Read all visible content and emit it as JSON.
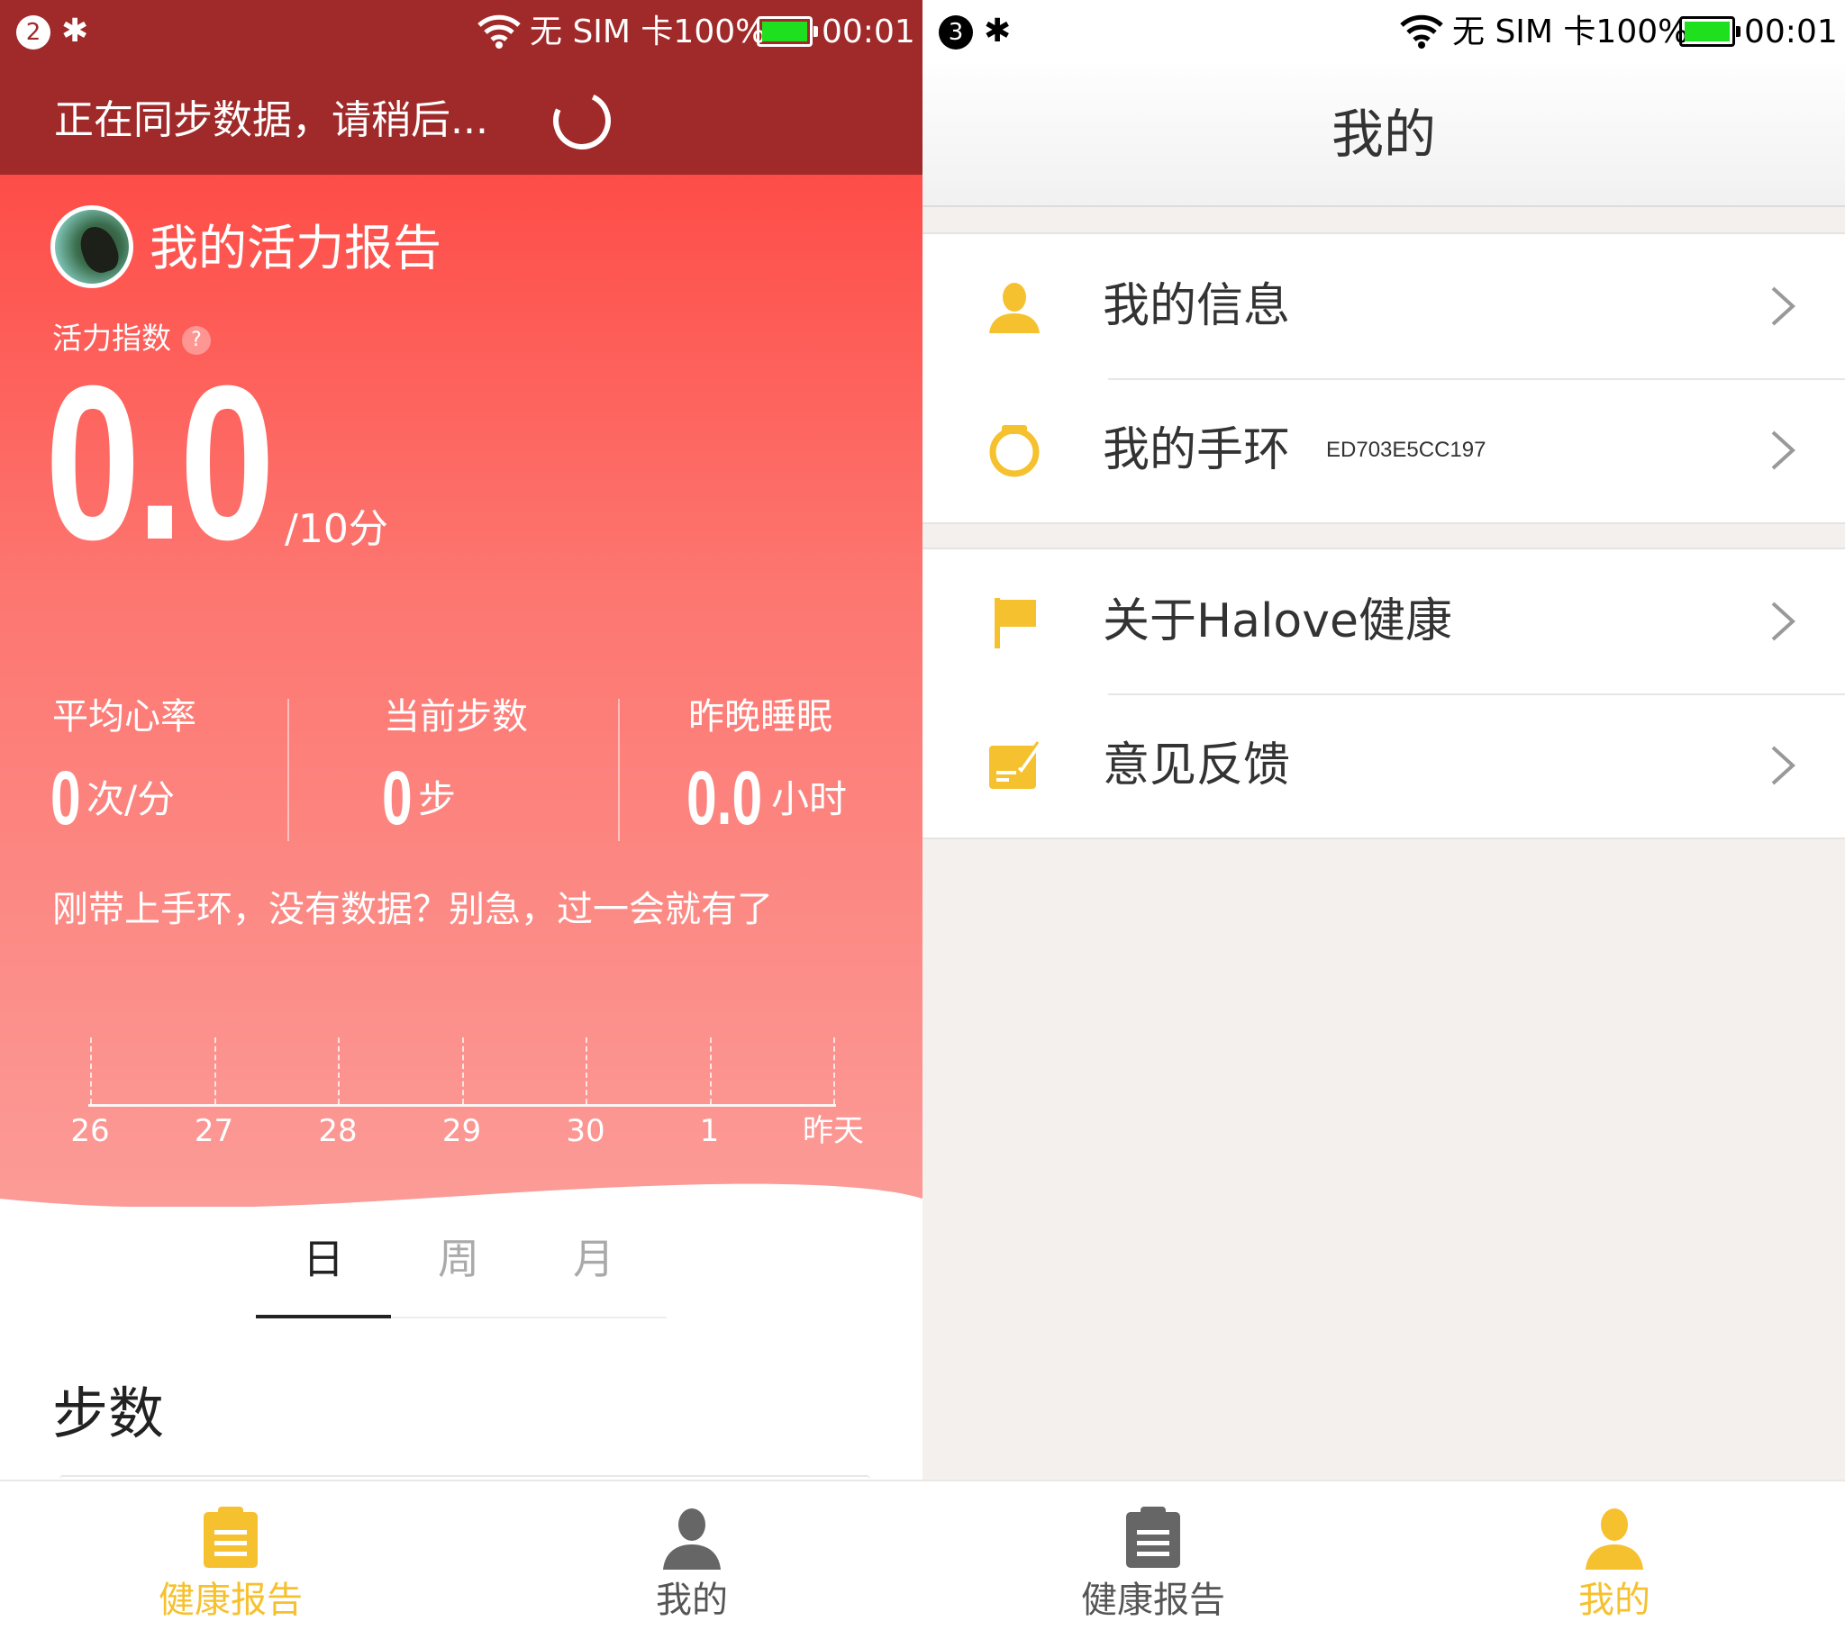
{
  "left": {
    "status_bar": {
      "notification_count": "2",
      "sim_text": "无 SIM 卡100%",
      "time": "00:01",
      "battery_color": "#1fe01f"
    },
    "sync_text": "正在同步数据，请稍后...",
    "report_title": "我的活力报告",
    "index_label": "活力指数",
    "help_glyph": "?",
    "score": {
      "value": "0.0",
      "unit": "/10分"
    },
    "stats": [
      {
        "label": "平均心率",
        "value": "0",
        "unit": "次/分"
      },
      {
        "label": "当前步数",
        "value": "0",
        "unit": "步"
      },
      {
        "label": "昨晚睡眠",
        "value": "0.0",
        "unit": "小时"
      }
    ],
    "hint": "刚带上手环，没有数据？别急，过一会就有了",
    "timeline_labels": [
      "26",
      "27",
      "28",
      "29",
      "30",
      "1",
      "昨天"
    ],
    "period_tabs": [
      "日",
      "周",
      "月"
    ],
    "active_period": "日",
    "steps_title": "步数",
    "colors": {
      "header_dark": "#a02a2a",
      "hero_top": "#fe4d48",
      "hero_bottom": "#fc9b97",
      "accent": "#f6c12e"
    }
  },
  "right": {
    "status_bar": {
      "notification_count": "3",
      "sim_text": "无 SIM 卡100%",
      "time": "00:01"
    },
    "header_title": "我的",
    "menu_groups": [
      [
        {
          "label": "我的信息",
          "icon": "person-icon"
        },
        {
          "label": "我的手环",
          "sub": "ED703E5CC197",
          "icon": "band-icon"
        }
      ],
      [
        {
          "label": "关于Halove健康",
          "icon": "flag-icon"
        },
        {
          "label": "意见反馈",
          "icon": "feedback-icon"
        }
      ]
    ]
  },
  "bottom_nav": [
    {
      "label": "健康报告",
      "icon": "clipboard-icon"
    },
    {
      "label": "我的",
      "icon": "person-icon"
    }
  ],
  "nav_colors": {
    "active": "#f6c12e",
    "inactive": "#555555",
    "inactive_icon": "#666666"
  }
}
